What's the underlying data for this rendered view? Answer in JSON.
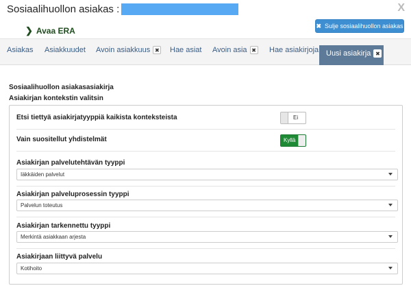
{
  "header": {
    "title": "Sosiaalihuollon asiakas :",
    "era_link": "Avaa ERA",
    "close_service_button": "Sulje sosiaalihuollon asiakas",
    "close_x": "X"
  },
  "tabs": [
    {
      "label": "Asiakas",
      "closable": false
    },
    {
      "label": "Asiakkuudet",
      "closable": false
    },
    {
      "label": "Avoin asiakkuus",
      "closable": true
    },
    {
      "label": "Hae asiat",
      "closable": false
    },
    {
      "label": "Avoin asia",
      "closable": true
    },
    {
      "label": "Hae asiakirjoja",
      "closable": false
    },
    {
      "label": "Uusi asiakirja",
      "closable": true,
      "active": true
    }
  ],
  "tab_close_glyph": "✖",
  "content": {
    "section_title": "Sosiaalihuollon asiakasasiakirja",
    "section_subtitle": "Asiakirjan kontekstin valitsin",
    "toggles": [
      {
        "label": "Etsi tiettyä asiakirjatyyppiä kaikista konteksteista",
        "state": "Ei",
        "on": false
      },
      {
        "label": "Vain suositellut yhdistelmät",
        "state": "Kyllä",
        "on": true
      }
    ],
    "selects": [
      {
        "label": "Asiakirjan palvelutehtävän tyyppi",
        "value": "Iäkkäiden palvelut"
      },
      {
        "label": "Asiakirjan palveluprosessin tyyppi",
        "value": "Palvelun toteutus"
      },
      {
        "label": "Asiakirjan tarkennettu tyyppi",
        "value": "Merkintä asiakkaan arjesta"
      },
      {
        "label": "Asiakirjaan liittyvä palvelu",
        "value": "Kotihoito"
      }
    ]
  },
  "colors": {
    "accent_button": "#3d8fd2",
    "active_tab": "#5d7a98",
    "toggle_on": "#1f8a36",
    "redaction": "#57a9f4"
  }
}
